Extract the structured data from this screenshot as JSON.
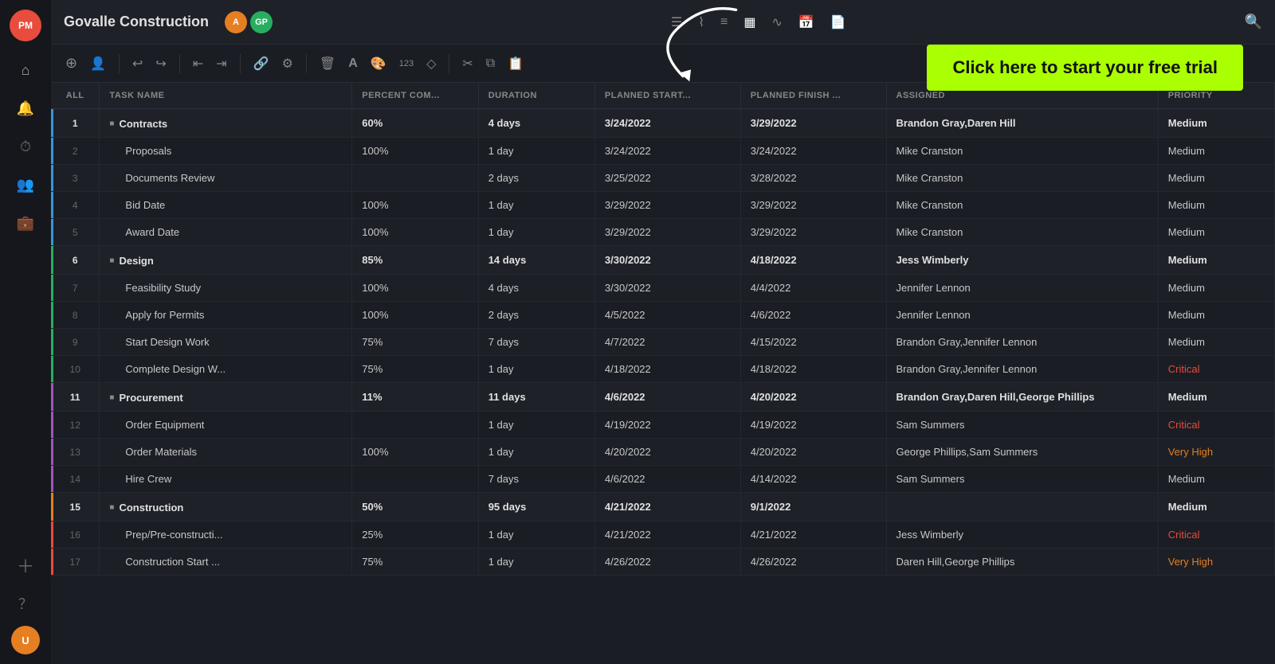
{
  "app": {
    "title": "Govalle Construction",
    "logo": "PM"
  },
  "header": {
    "avatars": [
      {
        "initials": "A",
        "color": "#e67e22"
      },
      {
        "initials": "GP",
        "color": "#27ae60"
      }
    ],
    "icons": [
      "list",
      "chart",
      "menu",
      "grid",
      "wave",
      "calendar",
      "doc",
      "search"
    ]
  },
  "toolbar": {
    "buttons": [
      "+",
      "👤",
      "↩",
      "↪",
      "⇤",
      "⇥",
      "🔗",
      "⚙",
      "🗑",
      "A",
      "🎨",
      "123",
      "◇",
      "|",
      "✂",
      "⧉",
      "📋"
    ]
  },
  "cta": {
    "text": "Click here to start your free trial"
  },
  "table": {
    "columns": [
      "ALL",
      "TASK NAME",
      "PERCENT COM...",
      "DURATION",
      "PLANNED START...",
      "PLANNED FINISH ...",
      "ASSIGNED",
      "PRIORITY"
    ],
    "rows": [
      {
        "num": "1",
        "name": "Contracts",
        "pct": "60%",
        "dur": "4 days",
        "start": "3/24/2022",
        "finish": "3/29/2022",
        "assigned": "Brandon Gray,Daren Hill",
        "priority": "Medium",
        "isGroup": true,
        "color": "#3498db",
        "expandIcon": "■"
      },
      {
        "num": "2",
        "name": "Proposals",
        "pct": "100%",
        "dur": "1 day",
        "start": "3/24/2022",
        "finish": "3/24/2022",
        "assigned": "Mike Cranston",
        "priority": "Medium",
        "isGroup": false,
        "color": "#3498db"
      },
      {
        "num": "3",
        "name": "Documents Review",
        "pct": "",
        "dur": "2 days",
        "start": "3/25/2022",
        "finish": "3/28/2022",
        "assigned": "Mike Cranston",
        "priority": "Medium",
        "isGroup": false,
        "color": "#3498db"
      },
      {
        "num": "4",
        "name": "Bid Date",
        "pct": "100%",
        "dur": "1 day",
        "start": "3/29/2022",
        "finish": "3/29/2022",
        "assigned": "Mike Cranston",
        "priority": "Medium",
        "isGroup": false,
        "color": "#3498db"
      },
      {
        "num": "5",
        "name": "Award Date",
        "pct": "100%",
        "dur": "1 day",
        "start": "3/29/2022",
        "finish": "3/29/2022",
        "assigned": "Mike Cranston",
        "priority": "Medium",
        "isGroup": false,
        "color": "#3498db"
      },
      {
        "num": "6",
        "name": "Design",
        "pct": "85%",
        "dur": "14 days",
        "start": "3/30/2022",
        "finish": "4/18/2022",
        "assigned": "Jess Wimberly",
        "priority": "Medium",
        "isGroup": true,
        "color": "#27ae60",
        "expandIcon": "■"
      },
      {
        "num": "7",
        "name": "Feasibility Study",
        "pct": "100%",
        "dur": "4 days",
        "start": "3/30/2022",
        "finish": "4/4/2022",
        "assigned": "Jennifer Lennon",
        "priority": "Medium",
        "isGroup": false,
        "color": "#27ae60"
      },
      {
        "num": "8",
        "name": "Apply for Permits",
        "pct": "100%",
        "dur": "2 days",
        "start": "4/5/2022",
        "finish": "4/6/2022",
        "assigned": "Jennifer Lennon",
        "priority": "Medium",
        "isGroup": false,
        "color": "#27ae60"
      },
      {
        "num": "9",
        "name": "Start Design Work",
        "pct": "75%",
        "dur": "7 days",
        "start": "4/7/2022",
        "finish": "4/15/2022",
        "assigned": "Brandon Gray,Jennifer Lennon",
        "priority": "Medium",
        "isGroup": false,
        "color": "#27ae60"
      },
      {
        "num": "10",
        "name": "Complete Design W...",
        "pct": "75%",
        "dur": "1 day",
        "start": "4/18/2022",
        "finish": "4/18/2022",
        "assigned": "Brandon Gray,Jennifer Lennon",
        "priority": "Critical",
        "isGroup": false,
        "color": "#27ae60"
      },
      {
        "num": "11",
        "name": "Procurement",
        "pct": "11%",
        "dur": "11 days",
        "start": "4/6/2022",
        "finish": "4/20/2022",
        "assigned": "Brandon Gray,Daren Hill,George Phillips",
        "priority": "Medium",
        "isGroup": true,
        "color": "#9b59b6",
        "expandIcon": "■"
      },
      {
        "num": "12",
        "name": "Order Equipment",
        "pct": "",
        "dur": "1 day",
        "start": "4/19/2022",
        "finish": "4/19/2022",
        "assigned": "Sam Summers",
        "priority": "Critical",
        "isGroup": false,
        "color": "#9b59b6"
      },
      {
        "num": "13",
        "name": "Order Materials",
        "pct": "100%",
        "dur": "1 day",
        "start": "4/20/2022",
        "finish": "4/20/2022",
        "assigned": "George Phillips,Sam Summers",
        "priority": "Very High",
        "isGroup": false,
        "color": "#9b59b6"
      },
      {
        "num": "14",
        "name": "Hire Crew",
        "pct": "",
        "dur": "7 days",
        "start": "4/6/2022",
        "finish": "4/14/2022",
        "assigned": "Sam Summers",
        "priority": "Medium",
        "isGroup": false,
        "color": "#9b59b6"
      },
      {
        "num": "15",
        "name": "Construction",
        "pct": "50%",
        "dur": "95 days",
        "start": "4/21/2022",
        "finish": "9/1/2022",
        "assigned": "",
        "priority": "Medium",
        "isGroup": true,
        "color": "#e67e22",
        "expandIcon": "■"
      },
      {
        "num": "16",
        "name": "Prep/Pre-constructi...",
        "pct": "25%",
        "dur": "1 day",
        "start": "4/21/2022",
        "finish": "4/21/2022",
        "assigned": "Jess Wimberly",
        "priority": "Critical",
        "isGroup": false,
        "color": "#e74c3c"
      },
      {
        "num": "17",
        "name": "Construction Start ...",
        "pct": "75%",
        "dur": "1 day",
        "start": "4/26/2022",
        "finish": "4/26/2022",
        "assigned": "Daren Hill,George Phillips",
        "priority": "Very High",
        "isGroup": false,
        "color": "#e74c3c"
      }
    ]
  },
  "sidebar": {
    "items": [
      {
        "icon": "⌂",
        "name": "home"
      },
      {
        "icon": "🔔",
        "name": "notifications"
      },
      {
        "icon": "⏱",
        "name": "time"
      },
      {
        "icon": "👥",
        "name": "team"
      },
      {
        "icon": "💼",
        "name": "portfolio"
      },
      {
        "icon": "＋",
        "name": "add"
      },
      {
        "icon": "？",
        "name": "help"
      }
    ]
  }
}
